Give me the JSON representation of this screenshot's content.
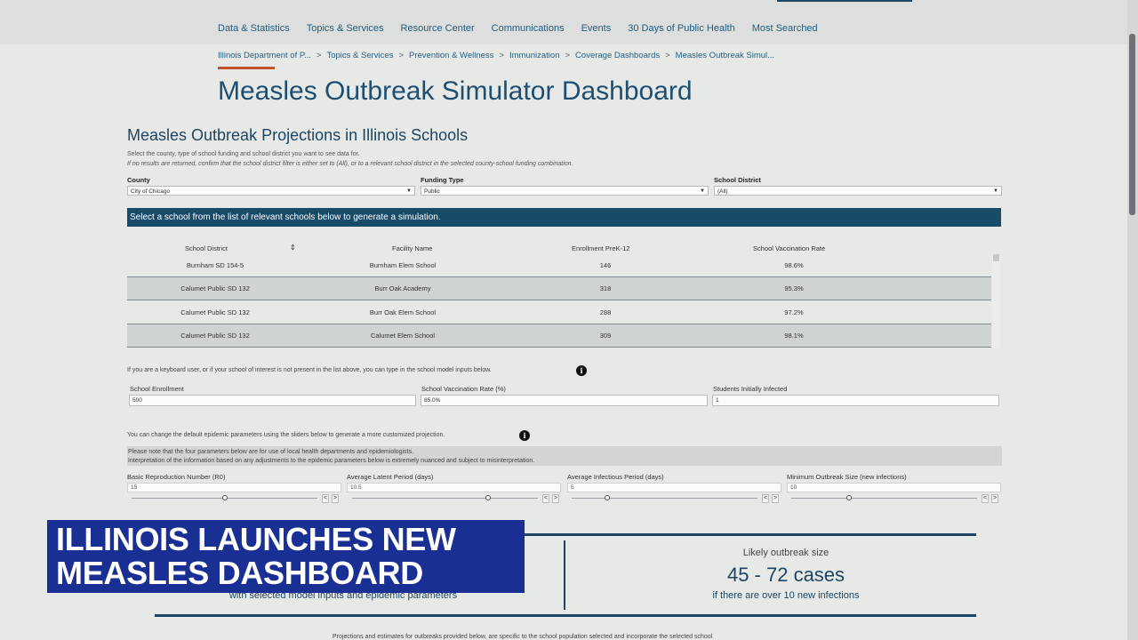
{
  "nav": [
    "Data & Statistics",
    "Topics & Services",
    "Resource Center",
    "Communications",
    "Events",
    "30 Days of Public Health",
    "Most Searched"
  ],
  "breadcrumb": [
    "Illinois Department of P...",
    "Topics & Services",
    "Prevention & Wellness",
    "Immunization",
    "Coverage Dashboards",
    "Measles Outbreak Simul..."
  ],
  "breadcrumb_separator": ">",
  "page_title": "Measles Outbreak Simulator Dashboard",
  "viz": {
    "title": "Measles Outbreak Projections in Illinois Schools",
    "instruction1": "Select the county, type of school funding and school district you want to see data for.",
    "instruction2": "If no results are returned, confirm that the school district filter is either set to (All), or to a relevant school district in the selected county-school funding combination.",
    "filters": [
      {
        "label": "County",
        "value": "City of Chicago"
      },
      {
        "label": "Funding Type",
        "value": "Public"
      },
      {
        "label": "School District",
        "value": "(All)"
      }
    ],
    "select_banner": "Select a school from the list of relevant schools below to generate a simulation."
  },
  "table": {
    "columns": [
      "School District",
      "Facility Name",
      "Enrollment PreK-12",
      "School Vaccination Rate"
    ],
    "sort_icon": "⇕",
    "rows": [
      [
        "Burnham SD 154-5",
        "Burnham Elem School",
        "146",
        "98.6%"
      ],
      [
        "Calumet Public SD 132",
        "Burr Oak Academy",
        "318",
        "95.3%"
      ],
      [
        "Calumet Public SD 132",
        "Burr Oak Elem School",
        "288",
        "97.2%"
      ],
      [
        "Calumet Public SD 132",
        "Calumet Elem School",
        "309",
        "98.1%"
      ]
    ]
  },
  "model_inputs": {
    "note": "If you are a keyboard user, or if your school of interest is not present in the list above, you can type in the school model inputs below.",
    "fields": [
      {
        "label": "School Enrollment",
        "value": "500"
      },
      {
        "label": "School Vaccination Rate (%)",
        "value": "85.0%"
      },
      {
        "label": "Students Initially Infected",
        "value": "1"
      }
    ]
  },
  "epidemic": {
    "note": "You can change the default epidemic parameters using the sliders below to generate a more customized projection.",
    "warning1": "Please note that the four parameters below are for use of local health departments and epidemiologists.",
    "warning2": "Interpretation of the information based on any adjustments to the epidemic parameters below is extremely nuanced and subject to misinterpretation.",
    "params": [
      {
        "label": "Basic Reproduction Number (R0)",
        "value": "15",
        "level": 0.5
      },
      {
        "label": "Average Latent Period (days)",
        "value": "10.5",
        "level": 0.73
      },
      {
        "label": "Average Infectious Period (days)",
        "value": "5",
        "level": 0.19
      },
      {
        "label": "Minimum Outbreak Size (new infections)",
        "value": "10",
        "level": 0.31
      }
    ],
    "stepper_prev": "<",
    "stepper_next": ">"
  },
  "info_icon": "i",
  "results": {
    "outbreak_label": "Likely outbreak size",
    "outbreak_value": "45 - 72 cases",
    "outbreak_sub": "if there are over 10 new infections",
    "left_sub": "with selected model inputs and epidemic parameters",
    "footnote": "Projections and estimates for outbreaks provided below, are specific to the school population selected and incorporate the selected school"
  },
  "chyron": {
    "line1": "ILLINOIS LAUNCHES NEW",
    "line2": "MEASLES DASHBOARD"
  },
  "colors": {
    "brand_blue": "#1d4f73",
    "banner": "#184a6a",
    "accent_orange": "#c2532d",
    "chyron_blue": "#1a2f93"
  }
}
